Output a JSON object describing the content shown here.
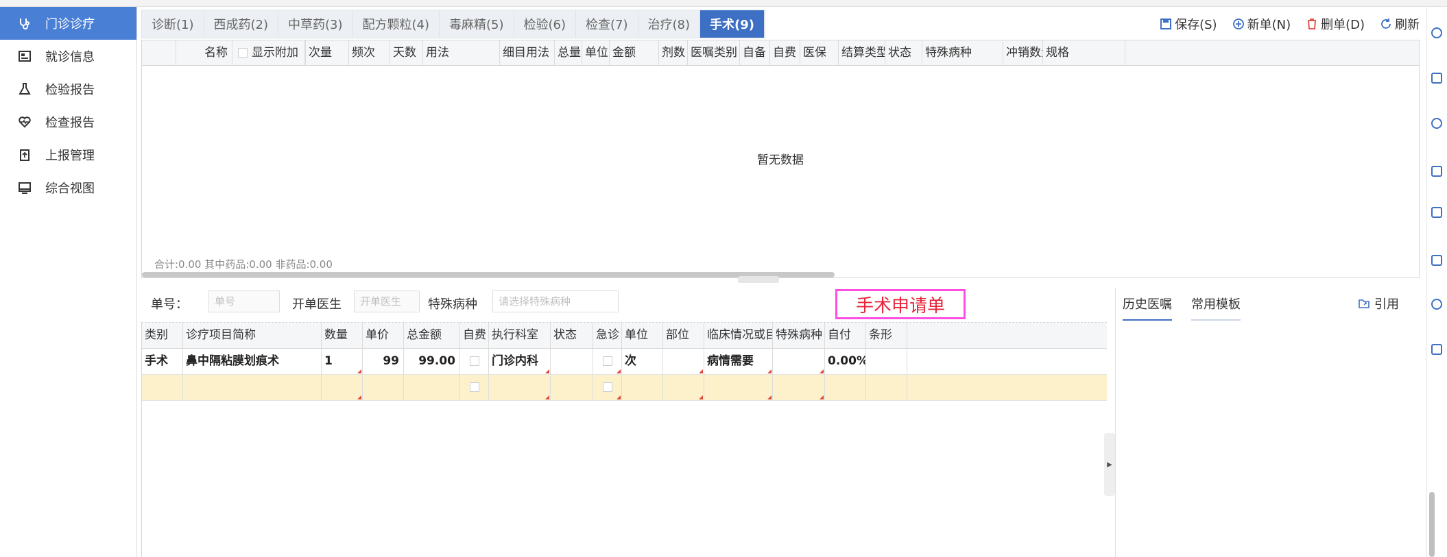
{
  "sidebar": {
    "items": [
      {
        "label": "门诊诊疗",
        "icon": "stethoscope-icon",
        "active": true
      },
      {
        "label": "就诊信息",
        "icon": "id-card-icon",
        "active": false
      },
      {
        "label": "检验报告",
        "icon": "flask-icon",
        "active": false
      },
      {
        "label": "检查报告",
        "icon": "heart-pulse-icon",
        "active": false
      },
      {
        "label": "上报管理",
        "icon": "clipboard-upload-icon",
        "active": false
      },
      {
        "label": "综合视图",
        "icon": "monitor-icon",
        "active": false
      }
    ]
  },
  "tabs": [
    {
      "label": "诊断(1)"
    },
    {
      "label": "西成药(2)"
    },
    {
      "label": "中草药(3)"
    },
    {
      "label": "配方颗粒(4)"
    },
    {
      "label": "毒麻精(5)"
    },
    {
      "label": "检验(6)"
    },
    {
      "label": "检查(7)"
    },
    {
      "label": "治疗(8)"
    },
    {
      "label": "手术(9)",
      "active": true
    }
  ],
  "toolbar": {
    "save": "保存(S)",
    "new": "新单(N)",
    "delete": "删单(D)",
    "refresh": "刷新"
  },
  "upper_grid": {
    "columns": [
      "名称",
      "显示附加",
      "次量",
      "频次",
      "天数",
      "用法",
      "细目用法",
      "总量",
      "单位",
      "金额",
      "剂数",
      "医嘱类别",
      "自备",
      "自费",
      "医保",
      "结算类型",
      "状态",
      "特殊病种",
      "冲销数量",
      "规格"
    ],
    "empty_text": "暂无数据",
    "totals": "合计:0.00   其中药品:0.00   非药品:0.00"
  },
  "form": {
    "order_no_label": "单号：",
    "order_no_placeholder": "单号",
    "doctor_label": "开单医生",
    "doctor_placeholder": "开单医生",
    "disease_label": "特殊病种",
    "disease_placeholder": "请选择特殊病种"
  },
  "banner": "手术申请单",
  "lower_grid": {
    "columns": [
      "类别",
      "诊疗项目简称",
      "数量",
      "单价",
      "总金额",
      "自费",
      "执行科室",
      "状态",
      "急诊",
      "单位",
      "部位",
      "临床情况或目的",
      "特殊病种",
      "自付",
      "条形"
    ],
    "rows": [
      {
        "category": "手术",
        "item": "鼻中隔粘膜划痕术",
        "qty": "1",
        "price": "99",
        "total": "99.00",
        "dept": "门诊内科",
        "status": "",
        "unit": "次",
        "site": "",
        "clinical": "病情需要",
        "disease": "",
        "self_pay": "0.00%"
      }
    ]
  },
  "right_panel": {
    "tabs": [
      "历史医嘱",
      "常用模板"
    ],
    "cite": "引用"
  },
  "colors": {
    "accent": "#3d6fc4",
    "banner_border": "#ff4fe1",
    "banner_text": "#e8233a",
    "new_row": "#fdf1cc"
  }
}
